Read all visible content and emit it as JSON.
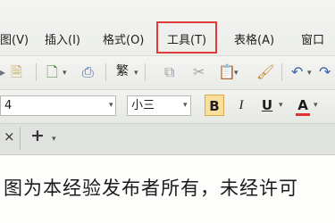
{
  "menubar": {
    "items": [
      {
        "label": "图(V)"
      },
      {
        "label": "插入(I)"
      },
      {
        "label": "格式(O)"
      },
      {
        "label": "工具(T)",
        "highlighted": true
      },
      {
        "label": "表格(A)"
      },
      {
        "label": "窗口"
      }
    ]
  },
  "toolbar_standard": {
    "icons": [
      "document-icon",
      "new-document-icon",
      "print-preview-icon",
      "font-style-icon",
      "copy-icon",
      "cut-icon",
      "paste-icon",
      "format-painter-icon",
      "undo-icon",
      "redo-icon"
    ],
    "style_label": "繁"
  },
  "toolbar_format": {
    "font_name_value": "4",
    "font_size_value": "小三",
    "bold_label": "B",
    "italic_label": "I",
    "underline_label": "U",
    "font_color_label": "A"
  },
  "tabstrip": {
    "close_label": "×",
    "add_label": "+"
  },
  "document": {
    "text": "图为本经验发布者所有，未经许可"
  },
  "colors": {
    "highlight_border": "#e03a3a",
    "bold_active": "#f9df9b"
  }
}
